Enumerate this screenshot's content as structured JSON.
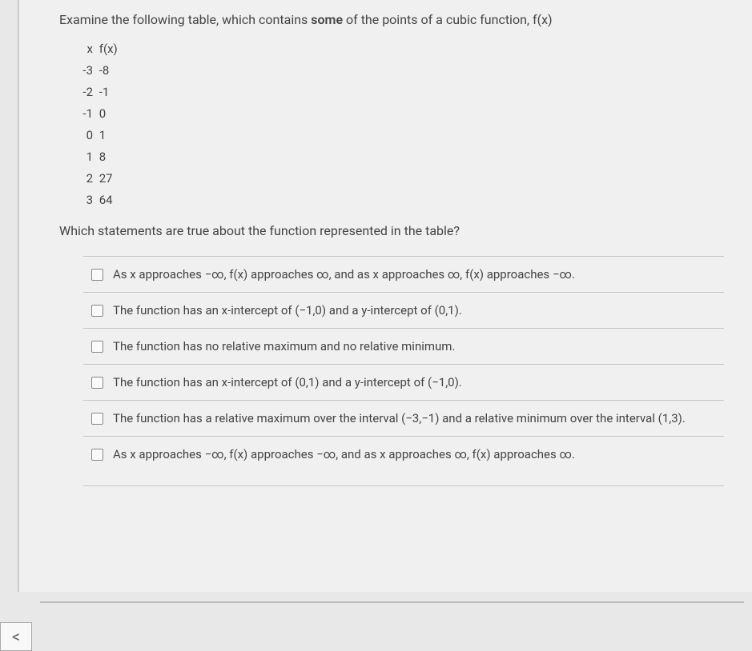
{
  "question": {
    "prompt_pre": "Examine the following table, which contains ",
    "prompt_bold": "some",
    "prompt_post": " of the points of a cubic function, f(x)",
    "table_header_x": "x",
    "table_header_fx": "f(x)",
    "table_rows": [
      {
        "x": "-3",
        "fx": "-8"
      },
      {
        "x": "-2",
        "fx": "-1"
      },
      {
        "x": "-1",
        "fx": "0"
      },
      {
        "x": "0",
        "fx": "1"
      },
      {
        "x": "1",
        "fx": "8"
      },
      {
        "x": "2",
        "fx": "27"
      },
      {
        "x": "3",
        "fx": "64"
      }
    ],
    "sub_prompt": "Which statements are true about the function represented in the table?",
    "options": [
      "As x approaches −∞, f(x) approaches ∞, and as x approaches ∞, f(x) approaches −∞.",
      "The function has an x-intercept of (−1,0) and a y-intercept of (0,1).",
      "The function has no relative maximum and no relative minimum.",
      "The function has an x-intercept of (0,1) and a y-intercept of (−1,0).",
      "The function has a relative maximum over the interval (−3,−1) and a relative minimum over the interval (1,3).",
      "As x approaches −∞, f(x) approaches −∞, and as x approaches ∞, f(x) approaches ∞."
    ]
  },
  "nav": {
    "prev": "<"
  }
}
